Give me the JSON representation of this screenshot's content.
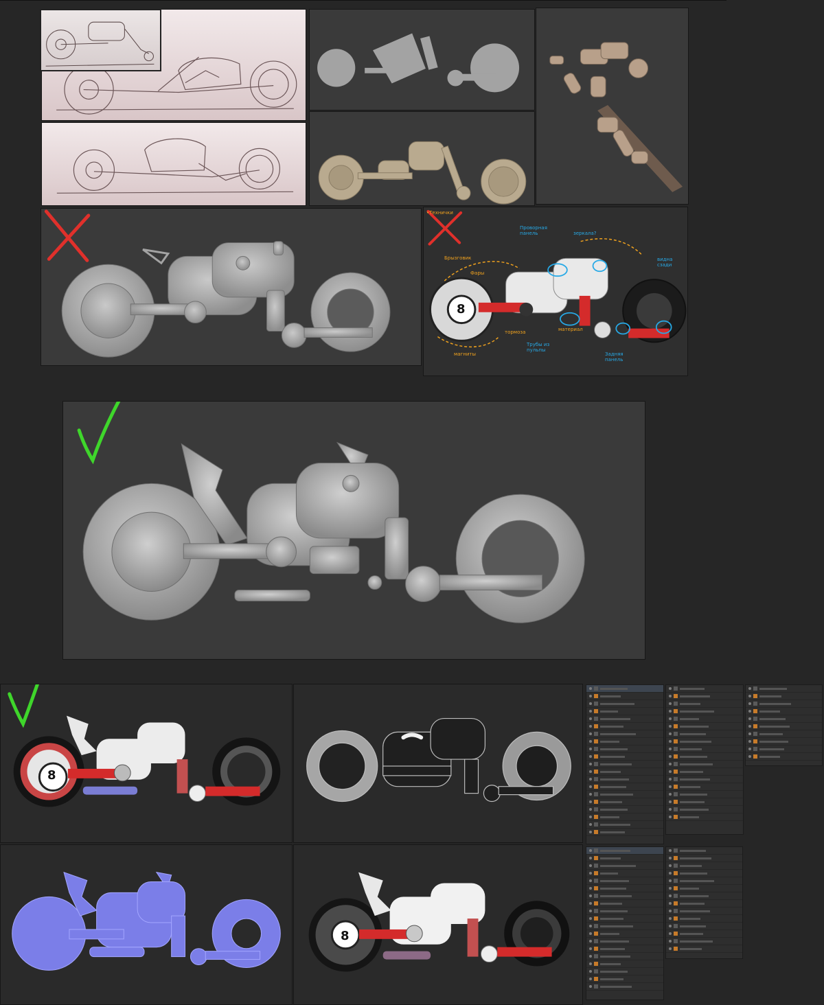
{
  "annotations": {
    "badge_number": "8",
    "tag_notes": "•Технички",
    "panel_top_notes": "Проворная панель",
    "mirror_notes": "зеркала?",
    "material_notes": "материал",
    "fender_note": "Брызговик",
    "round_light_note": "Фары",
    "shape_note": "видна сзади",
    "pipes_note": "Трубы из пульпы",
    "magnet_note": "магниты",
    "light_note": "тормоза",
    "rear_note": "Задняя панель"
  },
  "verdicts": {
    "rejected_1": "rejected",
    "rejected_2": "rejected",
    "approved_1": "approved",
    "approved_2": "approved"
  },
  "colors": {
    "check": "#3fd62b",
    "cross": "#e0302b",
    "accent_red": "#d42b2b",
    "annotation_orange": "#f0a21e",
    "annotation_blue": "#27a9e6"
  }
}
